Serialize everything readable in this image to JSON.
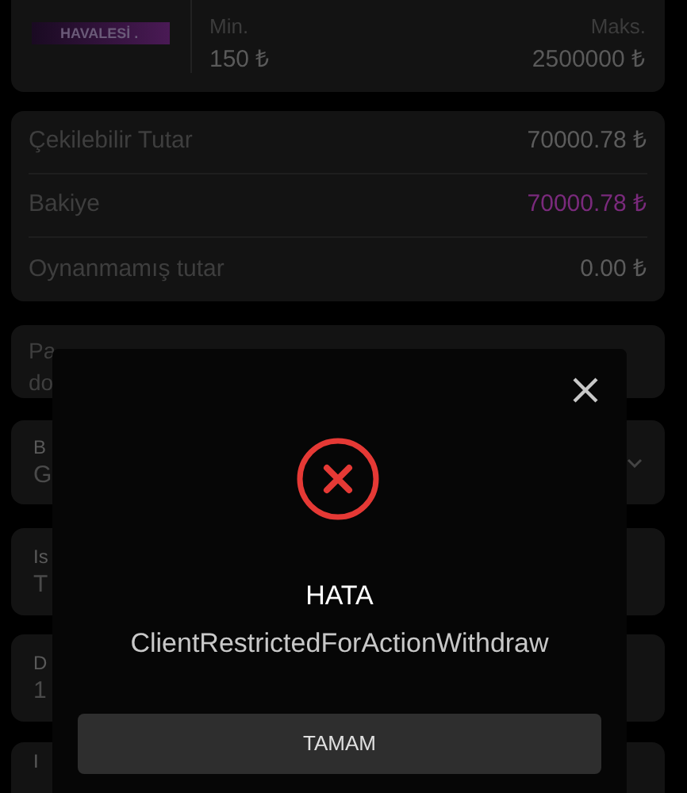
{
  "method_card": {
    "logo": "HAVALESİ .",
    "min_label": "Min.",
    "min_value": "150 ₺",
    "max_label": "Maks.",
    "max_value": "2500000 ₺"
  },
  "balances": [
    {
      "label": "Çekilebilir Tutar",
      "value": "70000.78 ₺",
      "highlight": false
    },
    {
      "label": "Bakiye",
      "value": "70000.78 ₺",
      "highlight": true
    },
    {
      "label": "Oynanmamış tutar",
      "value": "0.00 ₺",
      "highlight": false
    }
  ],
  "notice": {
    "lines": [
      "Pa",
      "do"
    ]
  },
  "fields": [
    {
      "label": "B",
      "value": "G",
      "kind": "select"
    },
    {
      "label": "Is",
      "value": "T",
      "kind": "input"
    },
    {
      "label": "D",
      "value": "1",
      "kind": "input"
    },
    {
      "label": "I",
      "kind": "input"
    }
  ],
  "dialog": {
    "title": "HATA",
    "message": "ClientRestrictedForActionWithdraw",
    "button": "TAMAM"
  }
}
